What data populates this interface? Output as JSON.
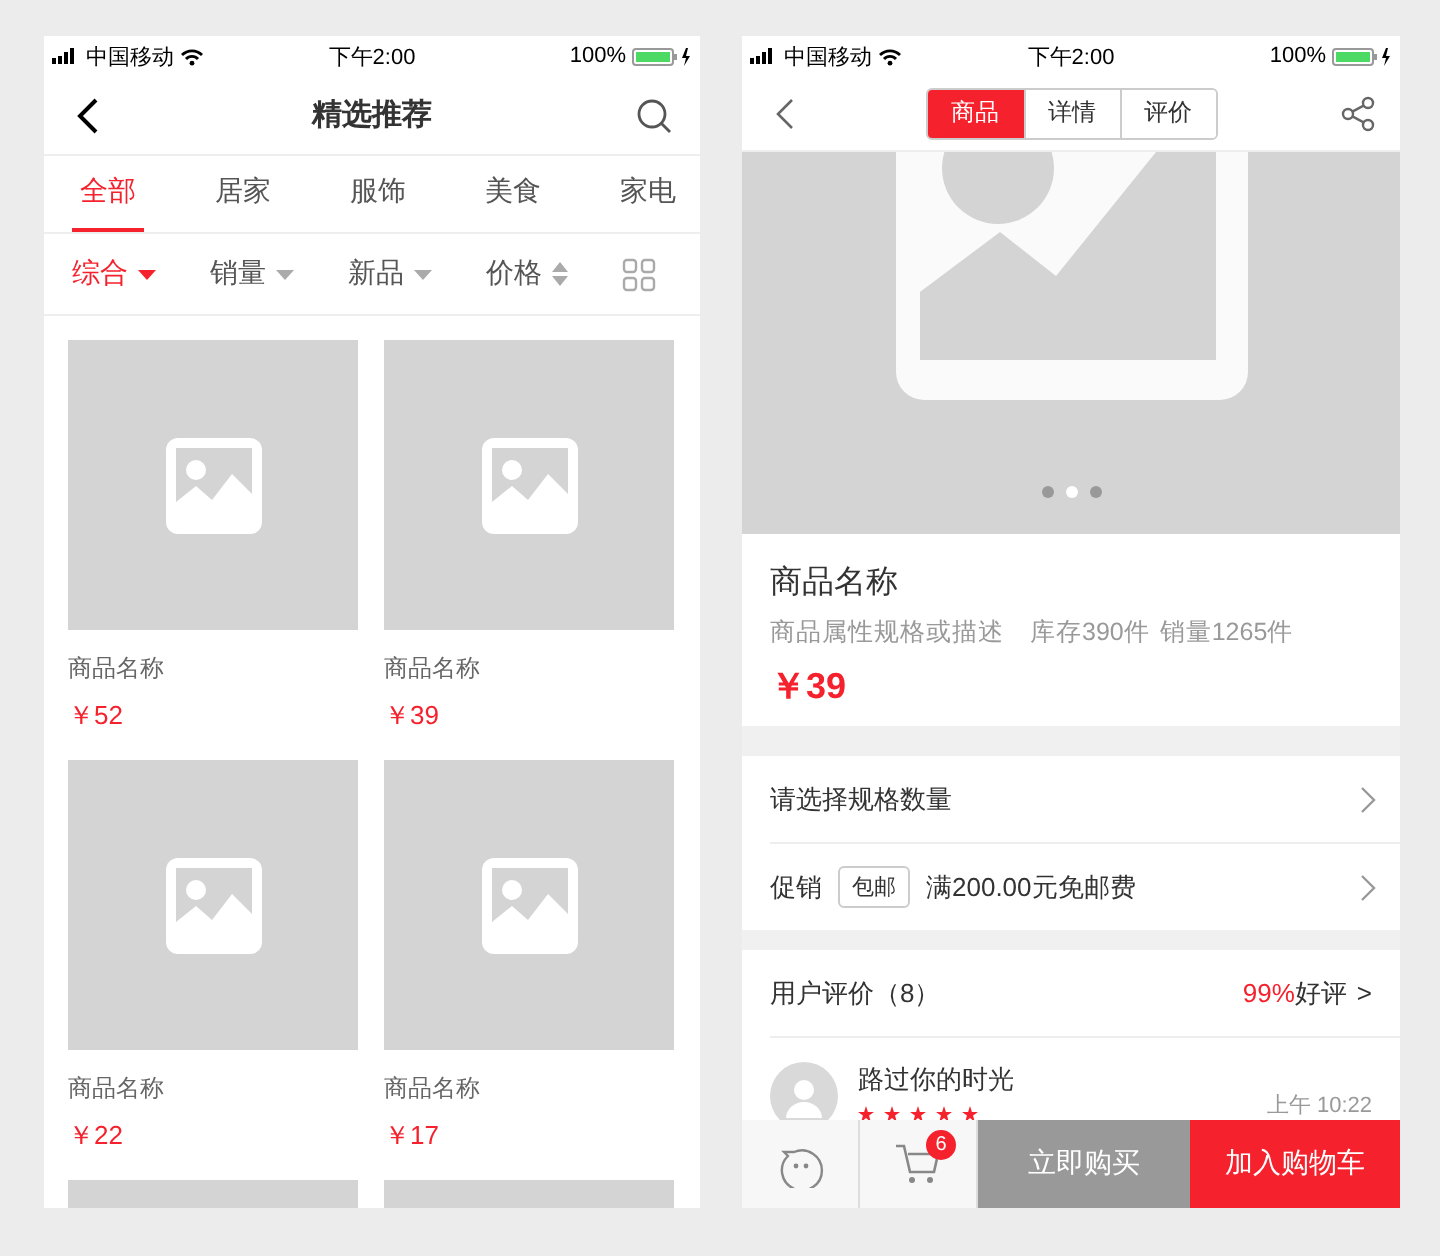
{
  "list_screen": {
    "status_bar": {
      "carrier": "中国移动",
      "time": "下午2:00",
      "battery": "100%"
    },
    "title": "精选推荐",
    "tabs": [
      {
        "label": "全部",
        "selected": true
      },
      {
        "label": "居家",
        "selected": false
      },
      {
        "label": "服饰",
        "selected": false
      },
      {
        "label": "美食",
        "selected": false
      },
      {
        "label": "家电",
        "selected": false
      }
    ],
    "filters": [
      {
        "label": "综合",
        "kind": "dropdown",
        "selected": true
      },
      {
        "label": "销量",
        "kind": "dropdown",
        "selected": false
      },
      {
        "label": "新品",
        "kind": "dropdown",
        "selected": false
      },
      {
        "label": "价格",
        "kind": "sort",
        "selected": false
      }
    ],
    "products": [
      {
        "kind": "full",
        "name": "商品名称",
        "price": "￥52"
      },
      {
        "kind": "full",
        "name": "商品名称",
        "price": "￥39"
      },
      {
        "kind": "full",
        "name": "商品名称",
        "price": "￥22"
      },
      {
        "kind": "full",
        "name": "商品名称",
        "price": "￥17"
      },
      {
        "kind": "image_only"
      },
      {
        "kind": "image_only"
      }
    ]
  },
  "detail_screen": {
    "status_bar": {
      "carrier": "中国移动",
      "time": "下午2:00",
      "battery": "100%"
    },
    "segments": [
      {
        "label": "商品",
        "selected": true
      },
      {
        "label": "详情",
        "selected": false
      },
      {
        "label": "评价",
        "selected": false
      }
    ],
    "carousel_dots": [
      {
        "selected": false
      },
      {
        "selected": true
      },
      {
        "selected": false
      }
    ],
    "product": {
      "name": "商品名称",
      "description": "商品属性规格或描述",
      "stock": "库存390件",
      "sales": "销量1265件",
      "price": "￥39"
    },
    "options": [
      {
        "label": "请选择规格数量"
      },
      {
        "label": "促销",
        "tag": "包邮",
        "text": "满200.00元免邮费"
      }
    ],
    "reviews": {
      "title": "用户评价（8）",
      "rate": "99%",
      "rate_label": "好评",
      "more": ">",
      "items": [
        {
          "user": "路过你的时光",
          "time": "上午 10:22",
          "stars": 5
        }
      ]
    },
    "bottom_bar": {
      "cart_count": "6",
      "buy_now": "立即购买",
      "add_to_cart": "加入购物车"
    }
  }
}
